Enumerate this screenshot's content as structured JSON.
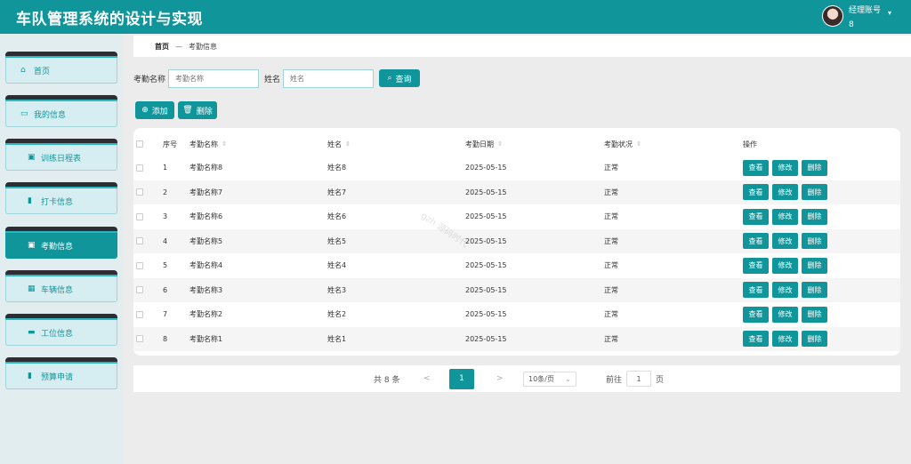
{
  "header": {
    "title": "车队管理系统的设计与实现",
    "user_name": "经理账号",
    "user_suffix": "8"
  },
  "sidebar": {
    "items": [
      {
        "label": "首页",
        "icon": "home-icon",
        "glyph": "⌂"
      },
      {
        "label": "我的信息",
        "icon": "id-card-icon",
        "glyph": "▭"
      },
      {
        "label": "训练日程表",
        "icon": "clipboard-icon",
        "glyph": "▣"
      },
      {
        "label": "打卡信息",
        "icon": "bar-chart-icon",
        "glyph": "▮"
      },
      {
        "label": "考勤信息",
        "icon": "clipboard-icon",
        "glyph": "▣"
      },
      {
        "label": "车辆信息",
        "icon": "grid-icon",
        "glyph": "▦"
      },
      {
        "label": "工位信息",
        "icon": "briefcase-icon",
        "glyph": "▬"
      },
      {
        "label": "预算申请",
        "icon": "chart-icon",
        "glyph": "▮"
      }
    ],
    "active_index": 4
  },
  "breadcrumb": {
    "home": "首页",
    "separator": "—",
    "current": "考勤信息"
  },
  "search": {
    "name_label": "考勤名称",
    "name_placeholder": "考勤名称",
    "person_label": "姓名",
    "person_placeholder": "姓名",
    "query_button": "查询"
  },
  "actions": {
    "add": "添加",
    "delete": "删除"
  },
  "table": {
    "headers": {
      "index": "序号",
      "name": "考勤名称",
      "person": "姓名",
      "date": "考勤日期",
      "status": "考勤状况",
      "ops": "操作"
    },
    "ops": {
      "view": "查看",
      "edit": "修改",
      "delete": "删除"
    },
    "rows": [
      {
        "index": "1",
        "name": "考勤名称8",
        "person": "姓名8",
        "date": "2025-05-15",
        "status": "正常"
      },
      {
        "index": "2",
        "name": "考勤名称7",
        "person": "姓名7",
        "date": "2025-05-15",
        "status": "正常"
      },
      {
        "index": "3",
        "name": "考勤名称6",
        "person": "姓名6",
        "date": "2025-05-15",
        "status": "正常"
      },
      {
        "index": "4",
        "name": "考勤名称5",
        "person": "姓名5",
        "date": "2025-05-15",
        "status": "正常"
      },
      {
        "index": "5",
        "name": "考勤名称4",
        "person": "姓名4",
        "date": "2025-05-15",
        "status": "正常"
      },
      {
        "index": "6",
        "name": "考勤名称3",
        "person": "姓名3",
        "date": "2025-05-15",
        "status": "正常"
      },
      {
        "index": "7",
        "name": "考勤名称2",
        "person": "姓名2",
        "date": "2025-05-15",
        "status": "正常"
      },
      {
        "index": "8",
        "name": "考勤名称1",
        "person": "姓名1",
        "date": "2025-05-15",
        "status": "正常"
      }
    ]
  },
  "pagination": {
    "total": "共 8 条",
    "prev": "<",
    "current_page": "1",
    "next": ">",
    "page_size": "10条/页",
    "goto_label": "前往",
    "goto_value": "1",
    "goto_suffix": "页"
  },
  "watermark": "gzh 源码时代",
  "colors": {
    "primary": "#10959a",
    "sidebar_bg": "#e2edf0",
    "page_bg": "#ececec"
  }
}
